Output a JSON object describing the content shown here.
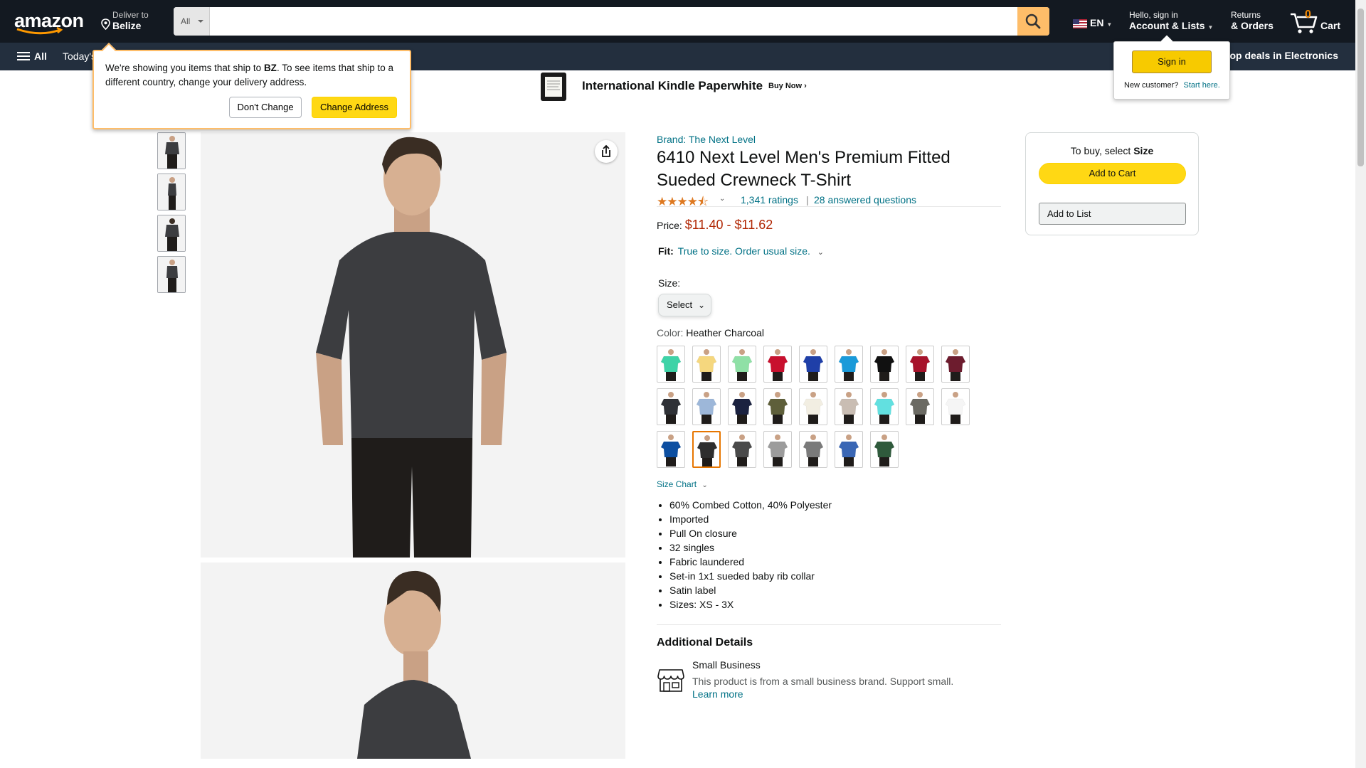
{
  "header": {
    "logo": "amazon",
    "deliver_line1": "Deliver to",
    "deliver_line2": "Belize",
    "search_category": "All",
    "search_value": "",
    "lang": "EN",
    "account_line1": "Hello, sign in",
    "account_line2": "Account & Lists",
    "returns_line1": "Returns",
    "returns_line2": "& Orders",
    "cart_count": "0",
    "cart_label": "Cart"
  },
  "subnav": {
    "all_label": "All",
    "today_label": "Today's",
    "deals_label": "op deals in Electronics"
  },
  "banner": {
    "title": "International Kindle Paperwhite",
    "cta": "Buy Now ›"
  },
  "delivery_popover": {
    "message_pre": "We're showing you items that ship to ",
    "country": "BZ",
    "message_post": ". To see items that ship to a different country, change your delivery address.",
    "dont_change": "Don't Change",
    "change_address": "Change Address"
  },
  "signin_popover": {
    "button": "Sign in",
    "new_customer": "New customer?",
    "start_here": "Start here."
  },
  "product": {
    "brand": "Brand: The Next Level",
    "title": "6410 Next Level Men's Premium Fitted Sueded Crewneck T-Shirt",
    "stars": "★★★★⯪",
    "ratings": "1,341 ratings",
    "answered": "28 answered questions",
    "price_label": "Price:",
    "price": "$11.40 - $11.62",
    "fit_label": "Fit:",
    "fit_text": "True to size. Order usual size.",
    "size_label": "Size:",
    "size_select": "Select",
    "color_label": "Color:",
    "color_value": "Heather Charcoal",
    "size_chart": "Size Chart",
    "bullets": [
      "60% Combed Cotton, 40% Polyester",
      "Imported",
      "Pull On closure",
      "32 singles",
      "Fabric laundered",
      "Set-in 1x1 sueded baby rib collar",
      "Satin label",
      "Sizes: XS - 3X"
    ],
    "additional_title": "Additional Details",
    "small_business_title": "Small Business",
    "small_business_desc": "This product is from a small business brand. Support small.",
    "learn_more": "Learn more"
  },
  "swatches": [
    "#3ed3a7",
    "#f5d77e",
    "#8fe0a6",
    "#c8102e",
    "#1f3fa8",
    "#1a9ad9",
    "#111111",
    "#a7122a",
    "#6d1c2e",
    "#2f3136",
    "#9db7d9",
    "#1b2240",
    "#5e5f3a",
    "#f2eee2",
    "#c9bdb3",
    "#62e0e0",
    "#6b6a63",
    "#f5f5f5",
    "#0d4fa1",
    "#2e2e2e",
    "#4a4a4a",
    "#9c9c9c",
    "#7a7a7a",
    "#3a67b5",
    "#2f5a3c"
  ],
  "buybox": {
    "heading_pre": "To buy, select ",
    "heading_bold": "Size",
    "add_to_cart": "Add to Cart",
    "add_to_list": "Add to List"
  },
  "colors": {
    "nav_dark": "#131921",
    "nav_sub": "#232f3e",
    "accent_yellow": "#ffd814",
    "price_red": "#b12704",
    "link": "#007185",
    "star_orange": "#de7921"
  }
}
